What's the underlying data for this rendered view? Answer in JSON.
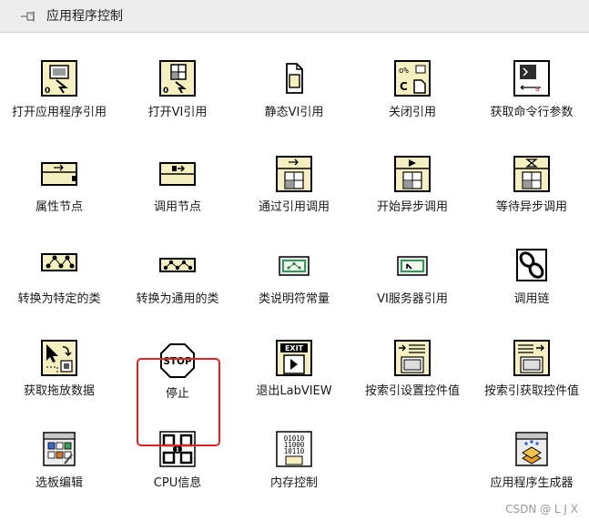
{
  "window": {
    "title": "应用程序控制",
    "pin_icon": "pushpin-icon"
  },
  "items": [
    {
      "label": "打开应用程序引用",
      "icon": "open-app-ref-icon"
    },
    {
      "label": "打开VI引用",
      "icon": "open-vi-ref-icon"
    },
    {
      "label": "静态VI引用",
      "icon": "static-vi-ref-icon"
    },
    {
      "label": "关闭引用",
      "icon": "close-ref-icon"
    },
    {
      "label": "获取命令行参数",
      "icon": "command-line-args-icon"
    },
    {
      "label": "属性节点",
      "icon": "property-node-icon"
    },
    {
      "label": "调用节点",
      "icon": "invoke-node-icon"
    },
    {
      "label": "通过引用调用",
      "icon": "call-by-ref-icon"
    },
    {
      "label": "开始异步调用",
      "icon": "start-async-call-icon"
    },
    {
      "label": "等待异步调用",
      "icon": "wait-async-call-icon"
    },
    {
      "label": "转换为特定的类",
      "icon": "to-specific-class-icon"
    },
    {
      "label": "转换为通用的类",
      "icon": "to-generic-class-icon"
    },
    {
      "label": "类说明符常量",
      "icon": "class-specifier-constant-icon"
    },
    {
      "label": "VI服务器引用",
      "icon": "vi-server-ref-icon"
    },
    {
      "label": "调用链",
      "icon": "call-chain-icon"
    },
    {
      "label": "获取拖放数据",
      "icon": "get-drag-drop-data-icon"
    },
    {
      "label": "停止",
      "icon": "stop-icon",
      "selected": true
    },
    {
      "label": "退出LabVIEW",
      "icon": "exit-labview-icon"
    },
    {
      "label": "按索引设置控件值",
      "icon": "set-control-value-icon"
    },
    {
      "label": "按索引获取控件值",
      "icon": "get-control-value-icon"
    },
    {
      "label": "选板编辑",
      "icon": "palette-edit-icon"
    },
    {
      "label": "CPU信息",
      "icon": "cpu-info-icon"
    },
    {
      "label": "内存控制",
      "icon": "memory-control-icon"
    },
    {
      "label": "应用程序生成器",
      "icon": "app-builder-icon"
    }
  ],
  "stop_icon_text": "STOP",
  "exit_icon_text": "EXIT",
  "watermark": "CSDN @ L J X",
  "colors": {
    "titlebar": "#ededed",
    "highlight": "#e02222",
    "icon_border": "#000000",
    "icon_fill": "#f6f0c0"
  }
}
